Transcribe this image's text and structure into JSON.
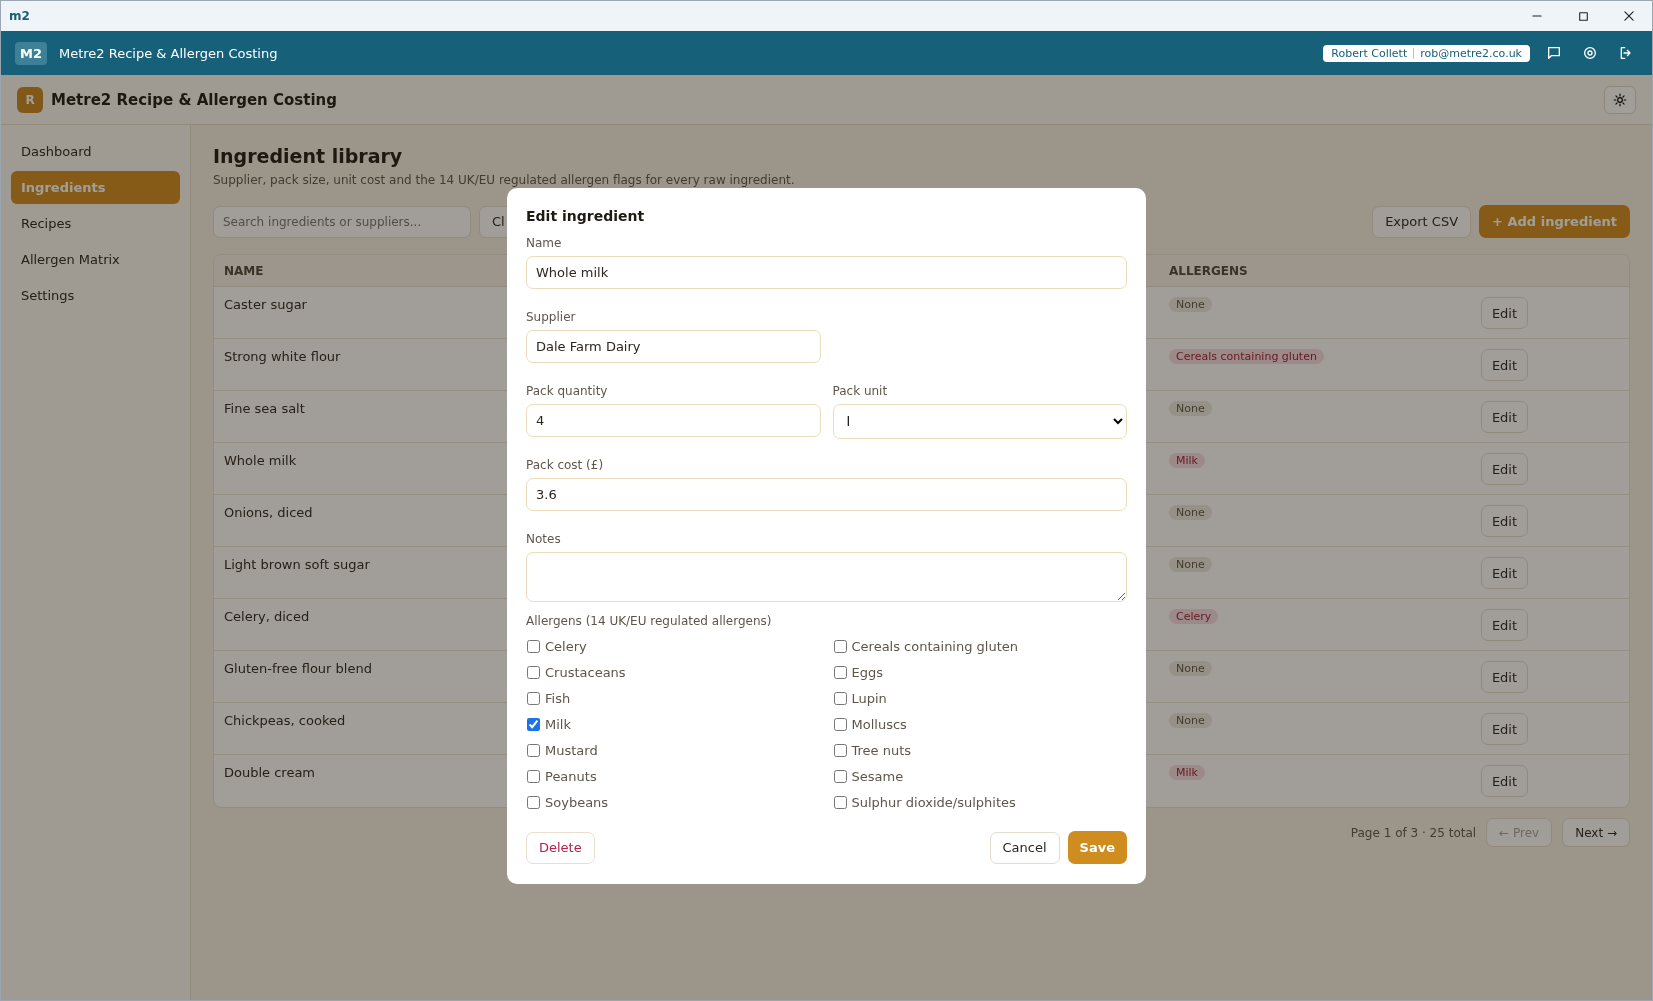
{
  "window": {
    "logo": "m2"
  },
  "app_header": {
    "logo": "M2",
    "title": "Metre2 Recipe & Allergen Costing",
    "user_name": "Robert Collett",
    "user_email": "rob@metre2.co.uk"
  },
  "sub_header": {
    "badge": "R",
    "title": "Metre2 Recipe & Allergen Costing"
  },
  "sidebar": {
    "items": [
      {
        "label": "Dashboard",
        "selected": false
      },
      {
        "label": "Ingredients",
        "selected": true
      },
      {
        "label": "Recipes",
        "selected": false
      },
      {
        "label": "Allergen Matrix",
        "selected": false
      },
      {
        "label": "Settings",
        "selected": false
      }
    ]
  },
  "page": {
    "title": "Ingredient library",
    "subtitle": "Supplier, pack size, unit cost and the 14 UK/EU regulated allergen flags for every raw ingredient.",
    "search_placeholder": "Search ingredients or suppliers...",
    "partial_button": "Cl",
    "export_button": "Export CSV",
    "add_button": "+ Add ingredient"
  },
  "table": {
    "columns": [
      "NAME",
      "ALLERGENS"
    ],
    "rows": [
      {
        "name": "Caster sugar",
        "allergens": [
          {
            "label": "None",
            "kind": "none"
          }
        ],
        "action": "Edit"
      },
      {
        "name": "Strong white flour",
        "allergens": [
          {
            "label": "Cereals containing gluten",
            "kind": "allergen"
          }
        ],
        "action": "Edit"
      },
      {
        "name": "Fine sea salt",
        "allergens": [
          {
            "label": "None",
            "kind": "none"
          }
        ],
        "action": "Edit"
      },
      {
        "name": "Whole milk",
        "allergens": [
          {
            "label": "Milk",
            "kind": "allergen"
          }
        ],
        "action": "Edit"
      },
      {
        "name": "Onions, diced",
        "allergens": [
          {
            "label": "None",
            "kind": "none"
          }
        ],
        "action": "Edit"
      },
      {
        "name": "Light brown soft sugar",
        "allergens": [
          {
            "label": "None",
            "kind": "none"
          }
        ],
        "action": "Edit"
      },
      {
        "name": "Celery, diced",
        "allergens": [
          {
            "label": "Celery",
            "kind": "allergen"
          }
        ],
        "action": "Edit"
      },
      {
        "name": "Gluten-free flour blend",
        "allergens": [
          {
            "label": "None",
            "kind": "none"
          }
        ],
        "action": "Edit"
      },
      {
        "name": "Chickpeas, cooked",
        "allergens": [
          {
            "label": "None",
            "kind": "none"
          }
        ],
        "action": "Edit"
      },
      {
        "name": "Double cream",
        "allergens": [
          {
            "label": "Milk",
            "kind": "allergen"
          }
        ],
        "action": "Edit"
      }
    ]
  },
  "pagination": {
    "summary": "Page 1 of 3 · 25 total",
    "prev": {
      "label": "← Prev",
      "disabled": true
    },
    "next": {
      "label": "Next →",
      "disabled": false
    }
  },
  "dialog": {
    "title": "Edit ingredient",
    "name": {
      "label": "Name",
      "value": "Whole milk"
    },
    "supplier": {
      "label": "Supplier",
      "value": "Dale Farm Dairy"
    },
    "pack_quantity": {
      "label": "Pack quantity",
      "value": "4"
    },
    "pack_unit": {
      "label": "Pack unit",
      "value": "l"
    },
    "pack_cost": {
      "label": "Pack cost (£)",
      "value": "3.6"
    },
    "notes": {
      "label": "Notes"
    },
    "allergens_label": "Allergens (14 UK/EU regulated allergens)",
    "allergens": [
      {
        "label": "Celery",
        "checked": false
      },
      {
        "label": "Cereals containing gluten",
        "checked": false
      },
      {
        "label": "Crustaceans",
        "checked": false
      },
      {
        "label": "Eggs",
        "checked": false
      },
      {
        "label": "Fish",
        "checked": false
      },
      {
        "label": "Lupin",
        "checked": false
      },
      {
        "label": "Milk",
        "checked": true
      },
      {
        "label": "Molluscs",
        "checked": false
      },
      {
        "label": "Mustard",
        "checked": false
      },
      {
        "label": "Tree nuts",
        "checked": false
      },
      {
        "label": "Peanuts",
        "checked": false
      },
      {
        "label": "Sesame",
        "checked": false
      },
      {
        "label": "Soybeans",
        "checked": false
      },
      {
        "label": "Sulphur dioxide/sulphites",
        "checked": false
      }
    ],
    "delete_button": "Delete",
    "cancel_button": "Cancel",
    "save_button": "Save"
  }
}
